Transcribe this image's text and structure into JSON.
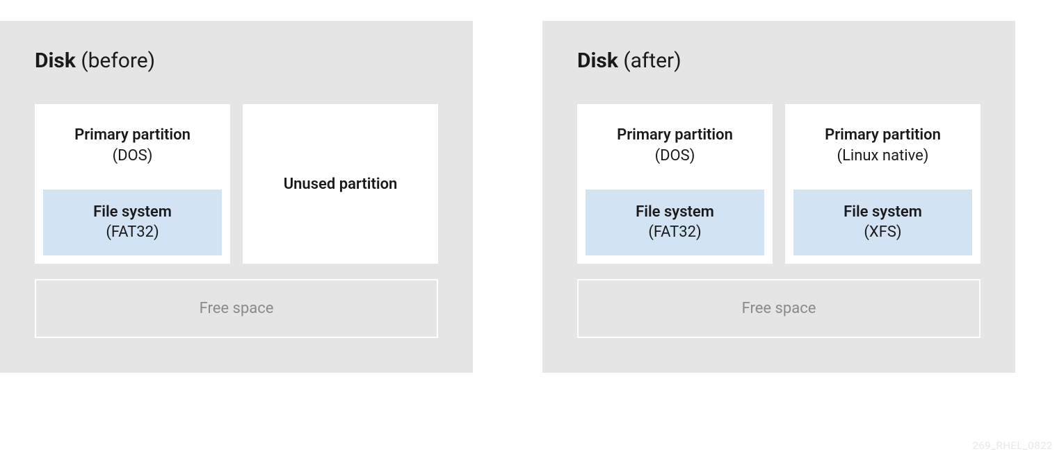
{
  "before": {
    "title_bold": "Disk",
    "title_rest": " (before)",
    "partitions": [
      {
        "title": "Primary partition",
        "subtitle": "(DOS)",
        "filesystem_title": "File system",
        "filesystem_subtitle": "(FAT32)"
      },
      {
        "unused_label": "Unused partition"
      }
    ],
    "free_space": "Free space"
  },
  "after": {
    "title_bold": "Disk",
    "title_rest": " (after)",
    "partitions": [
      {
        "title": "Primary partition",
        "subtitle": "(DOS)",
        "filesystem_title": "File system",
        "filesystem_subtitle": "(FAT32)"
      },
      {
        "title": "Primary partition",
        "subtitle": "(Linux native)",
        "filesystem_title": "File system",
        "filesystem_subtitle": "(XFS)"
      }
    ],
    "free_space": "Free space"
  },
  "watermark": "269_RHEL_0822"
}
